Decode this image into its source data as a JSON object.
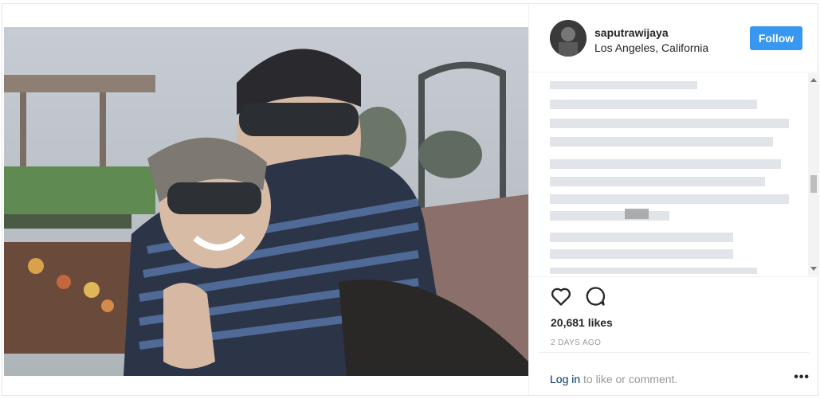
{
  "post": {
    "username": "saputrawijaya",
    "location": "Los Angeles, California",
    "follow_label": "Follow",
    "likes": "20,681 likes",
    "date": "2 DAYS AGO",
    "login_link": "Log in",
    "login_suffix": " to like or comment.",
    "more": "•••"
  },
  "icons": {
    "like": "heart-icon",
    "comment": "comment-icon",
    "more": "more-options-icon"
  },
  "colors": {
    "follow": "#3897f0",
    "link": "#003569",
    "muted": "#999999"
  }
}
